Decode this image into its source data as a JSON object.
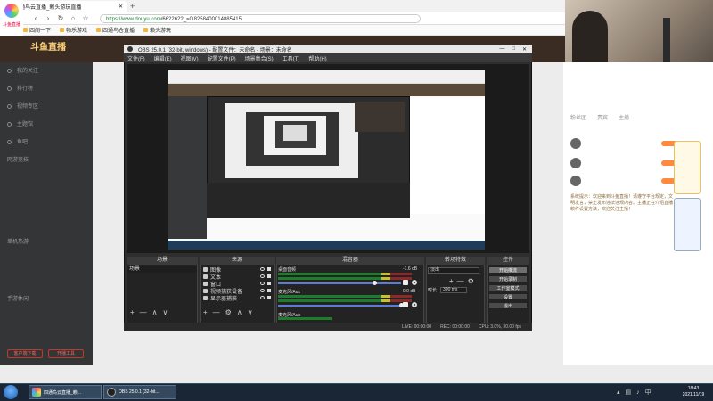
{
  "browser": {
    "tab_title": "四通鸟云直播_赖头游玩直播",
    "new_tab": "+",
    "url_host": "https://www.douyu.com",
    "url_path": "/662262?_=0.8258400014885415",
    "back": "‹",
    "forward": "›",
    "reload": "↻",
    "home": "⌂",
    "star": "☆",
    "bookmarks": [
      "四阁一下",
      "畅乐游戏",
      "四通鸟仓直播",
      "赖头游玩"
    ],
    "badge_label": "斗鱼直播"
  },
  "site": {
    "logo": "斗鱼直播",
    "nav_items": [
      "我的关注",
      "排行榜",
      "视频专区",
      "主题馆",
      "鱼吧"
    ],
    "sections": [
      "网游竞技",
      "单机热游",
      "手游休闲"
    ],
    "left_buttons": [
      "客户端下载",
      "开播工具"
    ],
    "chat_tabs": [
      "粉丝团",
      "贵宾",
      "主播"
    ],
    "chat_message": "系统提示：欢迎来到斗鱼直播！请遵守平台规定，文明发言，禁止发布违法违规内容。主播正在介绍直播软件设置方法，欢迎关注主播！"
  },
  "obs": {
    "title": "OBS 25.0.1 (32-bit, windows) - 配置文件：未命名 - 场景：未命名",
    "window_buttons": [
      "—",
      "□",
      "✕"
    ],
    "menu": [
      "文件(F)",
      "编辑(E)",
      "视图(V)",
      "配置文件(P)",
      "场景集合(S)",
      "工具(T)",
      "帮助(H)"
    ],
    "docks": {
      "scenes": "场景",
      "sources": "来源",
      "mixer": "混音器",
      "transitions": "转场特效",
      "controls": "控件"
    },
    "scene_selected": "场景",
    "sources": [
      "图像",
      "文本",
      "窗口",
      "视频捕获设备",
      "显示器捕获"
    ],
    "mixer": [
      {
        "label": "桌面音频",
        "db": "-1.6 dB"
      },
      {
        "label": "麦克风/Aux",
        "db": "0.0 dB"
      },
      {
        "label": "麦克风/Aux",
        "db": ""
      }
    ],
    "transition_type": "淡出",
    "duration_label": "时长",
    "duration_value": "300 ms",
    "controls": [
      "开始推流",
      "开始录制",
      "工作室模式",
      "设置",
      "退出"
    ],
    "status": [
      "LIVE: 00:00:00",
      "REC: 00:00:00",
      "CPU: 3.0%, 30.00 fps"
    ],
    "dock_tools": [
      "+",
      "—",
      "∧",
      "∨"
    ]
  },
  "taskbar": {
    "tasks": [
      "四通鸟云直播_赖...",
      "OBS 25.0.1 (32-bit..."
    ],
    "time": "18:43",
    "date": "2021/11/19"
  }
}
